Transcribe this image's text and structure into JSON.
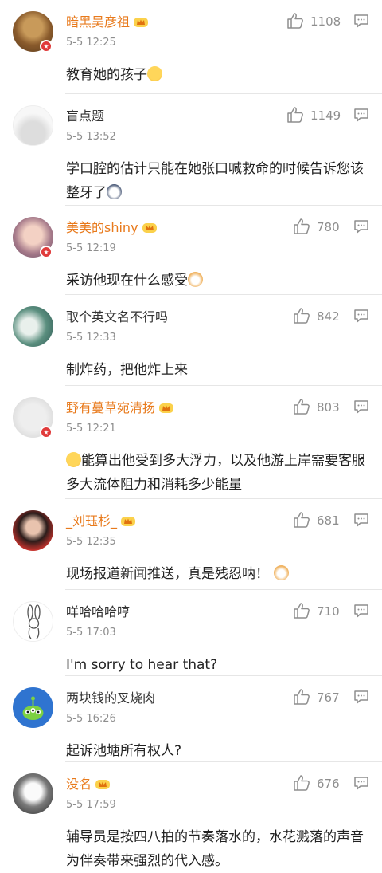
{
  "comments": [
    {
      "username": "暗黑吴彦祖",
      "vip": true,
      "time": "5-5 12:25",
      "likes": "1108",
      "text": "教育她的孩子",
      "emoji": "flushed-face-emoji"
    },
    {
      "username": "盲点题",
      "vip": false,
      "time": "5-5 13:52",
      "likes": "1149",
      "text": "学口腔的估计只能在她张口喊救命的时候告诉您该整牙了",
      "emoji": "husky-emoji"
    },
    {
      "username": "美美的shiny",
      "vip": true,
      "time": "5-5 12:19",
      "likes": "780",
      "text": "采访他现在什么感受",
      "emoji": "cat-emoji"
    },
    {
      "username": "取个英文名不行吗",
      "vip": false,
      "time": "5-5 12:33",
      "likes": "842",
      "text": "制炸药，把他炸上来",
      "emoji": ""
    },
    {
      "username": "野有蔓草宛清扬",
      "vip": true,
      "time": "5-5 12:21",
      "likes": "803",
      "text": "能算出他受到多大浮力，以及他游上岸需要客服多大流体阻力和消耗多少能量",
      "emoji": "sly-face-emoji"
    },
    {
      "username": "_刘珏杉_",
      "vip": true,
      "time": "5-5 12:35",
      "likes": "681",
      "text": "现场报道新闻推送，真是残忍呐！",
      "emoji": "cat-emoji"
    },
    {
      "username": "咩哈哈哈哼",
      "vip": false,
      "time": "5-5 17:03",
      "likes": "710",
      "text": "I'm sorry to hear that?",
      "emoji": ""
    },
    {
      "username": "两块钱的叉烧肉",
      "vip": false,
      "time": "5-5 16:26",
      "likes": "767",
      "text": "起诉池塘所有权人?",
      "emoji": ""
    },
    {
      "username": "没名",
      "vip": true,
      "time": "5-5 17:59",
      "likes": "676",
      "text": "辅导员是按四八拍的节奏落水的，水花溅落的声音为伴奏带来强烈的代入感。",
      "emoji": ""
    }
  ]
}
